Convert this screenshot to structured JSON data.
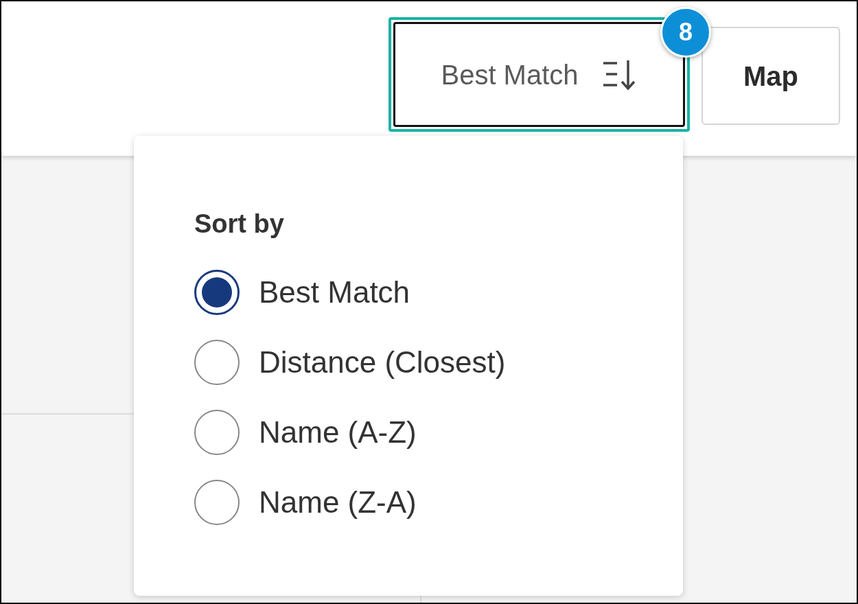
{
  "sort_button": {
    "label": "Best Match",
    "expanded": true,
    "focused": true
  },
  "step_badge": "8",
  "map_button": {
    "label": "Map"
  },
  "sort_menu": {
    "heading": "Sort by",
    "options": [
      {
        "label": "Best Match",
        "selected": true
      },
      {
        "label": "Distance (Closest)",
        "selected": false
      },
      {
        "label": "Name (A-Z)",
        "selected": false
      },
      {
        "label": "Name (Z-A)",
        "selected": false
      }
    ]
  }
}
